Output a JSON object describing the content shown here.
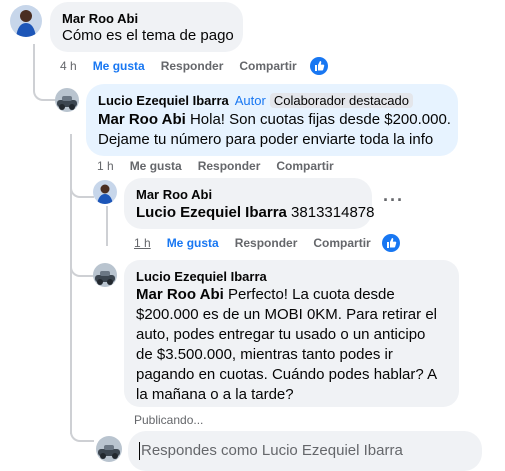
{
  "comments": {
    "c1": {
      "author": "Mar Roo Abi",
      "text": "Cómo es el tema de pago",
      "time": "4 h",
      "like": "Me gusta",
      "reply": "Responder",
      "share": "Compartir"
    },
    "c2": {
      "author": "Lucio Ezequiel Ibarra",
      "role": "Autor",
      "badge": "Colaborador destacado",
      "mention": "Mar Roo Abi",
      "text_line1": " Hola! Son cuotas fijas desde $200.000.",
      "text_line2": "Dejame tu número para poder enviarte toda la info",
      "time": "1 h",
      "like": "Me gusta",
      "reply": "Responder",
      "share": "Compartir"
    },
    "c3": {
      "author": "Mar Roo Abi",
      "mention": "Lucio Ezequiel Ibarra",
      "text": " 3813314878",
      "time": "1 h",
      "like": "Me gusta",
      "reply": "Responder",
      "share": "Compartir"
    },
    "c4": {
      "author": "Lucio Ezequiel Ibarra",
      "mention": "Mar Roo Abi",
      "text_line1": " Perfecto! La cuota desde",
      "text_line2": "$200.000 es de un MOBI 0KM. Para retirar el",
      "text_line3": "auto, podes entregar tu usado o un anticipo",
      "text_line4": "de $3.500.000, mientras tanto podes ir",
      "text_line5": "pagando en cuotas. Cuándo podes hablar? A",
      "text_line6": "la mañana o a la tarde?",
      "status": "Publicando..."
    }
  },
  "composer": {
    "placeholder": "Respondes como Lucio Ezequiel Ibarra"
  },
  "icons": {
    "more": "more-options-icon",
    "like_reaction": "like-reaction-icon"
  },
  "colors": {
    "accent": "#1877f2",
    "bubble": "#f0f2f5",
    "highlight_bubble": "#e7f3ff",
    "secondary_text": "#65676b"
  }
}
